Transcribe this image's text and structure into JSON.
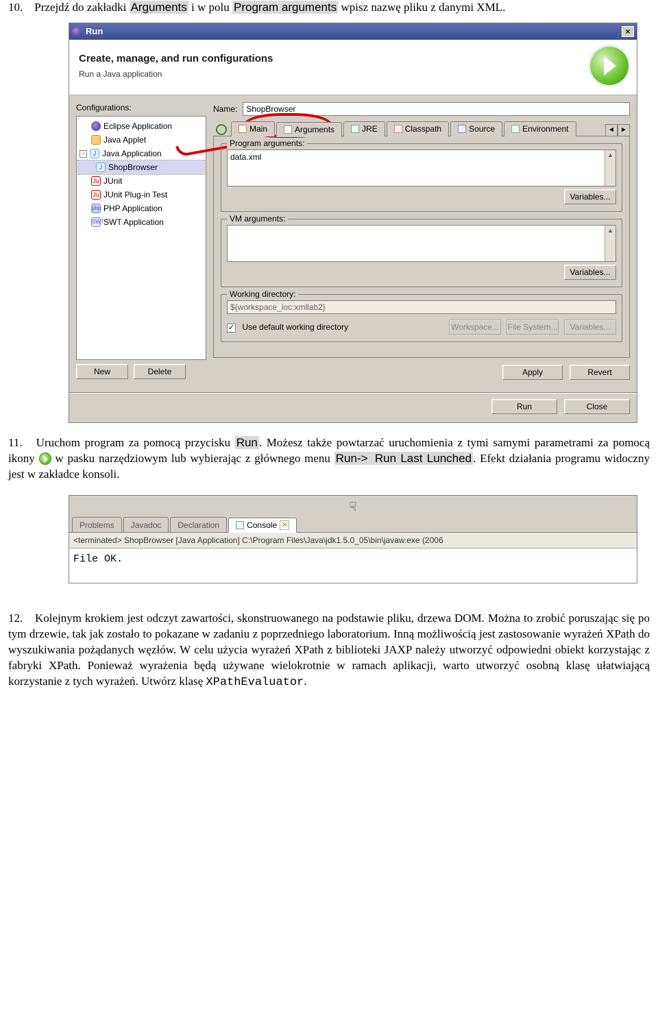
{
  "step10": {
    "num": "10.",
    "t1": "Przejdź do zakładki ",
    "hl1": "Arguments",
    "t2": " i w polu ",
    "hl2": "Program arguments",
    "t3": " wpisz nazwę pliku z danymi XML."
  },
  "dlg": {
    "title": "Run",
    "close": "×",
    "banner_title": "Create, manage, and run configurations",
    "banner_sub": "Run a Java application",
    "configurations_label": "Configurations:",
    "tree": [
      {
        "kind": "node",
        "icon": "ic-ecl",
        "label": "Eclipse Application",
        "indent": 0,
        "twisty": ""
      },
      {
        "kind": "node",
        "icon": "ic-app",
        "label": "Java Applet",
        "indent": 0,
        "twisty": ""
      },
      {
        "kind": "node",
        "icon": "ic-j",
        "label": "Java Application",
        "indent": 0,
        "twisty": "-",
        "iconText": "J"
      },
      {
        "kind": "leaf",
        "icon": "ic-j",
        "label": "ShopBrowser",
        "indent": 1,
        "selected": true,
        "iconText": "J"
      },
      {
        "kind": "node",
        "icon": "ic-ju",
        "label": "JUnit",
        "indent": 0,
        "iconText": "Ju"
      },
      {
        "kind": "node",
        "icon": "ic-ju",
        "label": "JUnit Plug-in Test",
        "indent": 0,
        "iconText": "Ju"
      },
      {
        "kind": "node",
        "icon": "ic-php",
        "label": "PHP Application",
        "indent": 0,
        "iconText": "php"
      },
      {
        "kind": "node",
        "icon": "ic-swt",
        "label": "SWT Application",
        "indent": 0,
        "iconText": "SWT"
      }
    ],
    "btn_new": "New",
    "btn_delete": "Delete",
    "name_label": "Name:",
    "name_value": "ShopBrowser",
    "tabs": [
      {
        "id": "main",
        "label": "Main",
        "ico": "tico-refresh"
      },
      {
        "id": "args",
        "label": "Arguments",
        "ico": "tico-var",
        "selected": true
      },
      {
        "id": "jre",
        "label": "JRE",
        "ico": "tico-jre"
      },
      {
        "id": "cp",
        "label": "Classpath",
        "ico": "tico-cp"
      },
      {
        "id": "src",
        "label": "Source",
        "ico": "tico-src"
      },
      {
        "id": "env",
        "label": "Environment",
        "ico": "tico-env"
      }
    ],
    "tab_left": "◄",
    "tab_right": "►",
    "program_args_label": "Program arguments:",
    "program_args_value": "data.xml",
    "variables_btn": "Variables...",
    "vm_args_label": "VM arguments:",
    "wd_label": "Working directory:",
    "wd_value": "${workspace_loc:xmllab2}",
    "wd_checkbox": "✓",
    "wd_checkbox_label": "Use default working directory",
    "wd_workspace": "Workspace...",
    "wd_fs": "File System...",
    "wd_vars": "Variables...",
    "apply": "Apply",
    "revert": "Revert",
    "run": "Run",
    "close2": "Close"
  },
  "step11": {
    "num": "11.",
    "t1": "Uruchom program za pomocą przycisku ",
    "hl1": "Run",
    "t2": ". Możesz także powtarzać uruchomienia z tymi samymi parametrami za pomocą ikony ",
    "t3": " w pasku narzędziowym lub wybierając z głównego menu ",
    "hl2": "Run-> ",
    "hl3": "Run Last Lunched",
    "t4": ". Efekt działania programu widoczny jest w zakładce konsoli."
  },
  "console": {
    "hand_glyph": "☟",
    "tabs": [
      {
        "label": "Problems",
        "selected": false
      },
      {
        "label": "Javadoc",
        "selected": false
      },
      {
        "label": "Declaration",
        "selected": false
      },
      {
        "label": "Console",
        "selected": true,
        "close": "✕"
      }
    ],
    "status": "<terminated> ShopBrowser [Java Application] C:\\Program Files\\Java\\jdk1.5.0_05\\bin\\javaw.exe (2006",
    "output": "File OK."
  },
  "step12": {
    "num": "12.",
    "text": "Kolejnym krokiem jest odczyt zawartości, skonstruowanego na podstawie pliku, drzewa DOM. Można to zrobić poruszając się po tym drzewie, tak jak zostało to pokazane w zadaniu z poprzedniego laboratorium. Inną możliwością jest zastosowanie wyrażeń XPath do wyszukiwania pożądanych węzłów. W celu użycia wyrażeń XPath z biblioteki JAXP należy utworzyć odpowiedni obiekt korzystając z fabryki XPath. Ponieważ wyrażenia będą używane wielokrotnie w ramach aplikacji, warto utworzyć osobną klasę ułatwiającą korzystanie z tych wyrażeń. Utwórz klasę ",
    "classname": "XPathEvaluator",
    "dot": "."
  }
}
